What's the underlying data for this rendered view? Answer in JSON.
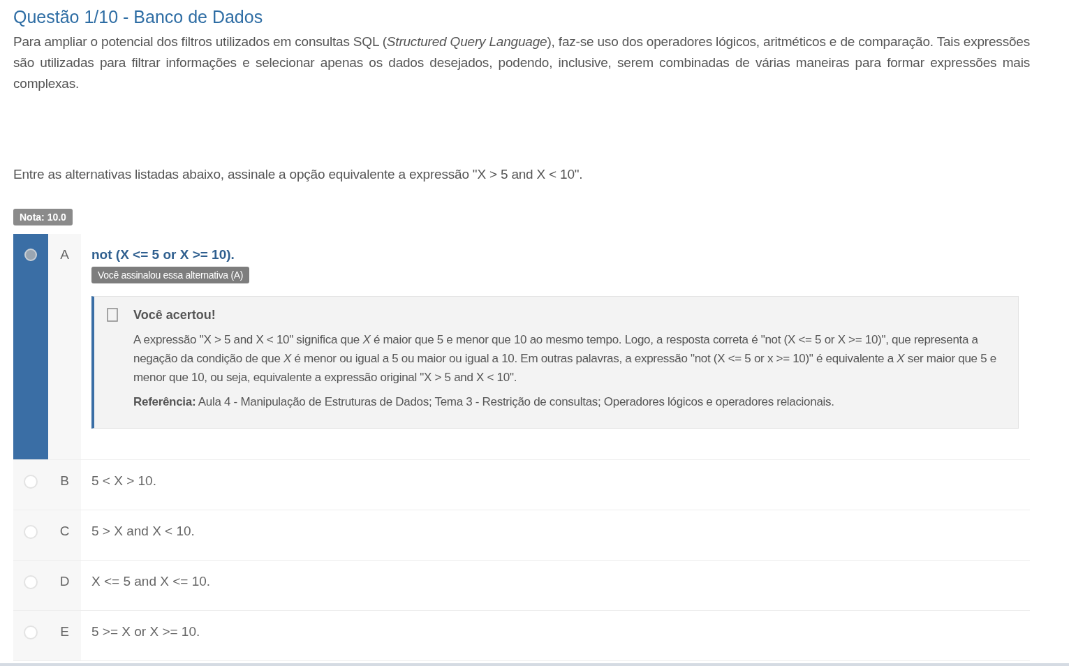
{
  "title": "Questão 1/10 - Banco de Dados",
  "intro": "Para ampliar o potencial dos filtros utilizados em consultas SQL (*Structured Query Language*), faz-se uso dos operadores lógicos, aritméticos e de comparação. Tais expressões são utilizadas para filtrar informações e selecionar apenas os dados desejados, podendo, inclusive, serem combinadas de várias maneiras para formar expressões mais complexas.",
  "question": "Entre as alternativas listadas abaixo, assinale a opção equivalente a expressão \"X > 5 and X < 10\".",
  "grade": "Nota: 10.0",
  "options": [
    {
      "letter": "A",
      "text": "not (X <= 5 or X >= 10).",
      "selected": true,
      "marked_label": "Você assinalou essa alternativa (A)",
      "feedback": {
        "title": "Você acertou!",
        "text": "A expressão \"X > 5 and X < 10\" significa que *X* é maior que 5 e menor que 10 ao mesmo tempo. Logo, a resposta correta é \"not (X <= 5 or X >= 10)\", que representa a negação da condição de que *X* é menor ou igual a 5 ou maior ou igual a 10. Em outras palavras, a expressão \"not (X <= 5 or x >= 10)\" é equivalente a *X* ser maior que 5 e menor que 10, ou seja, equivalente a expressão original \"X > 5 and X < 10\".",
        "reference": "**Referência:** Aula 4 - Manipulação de Estruturas de Dados; Tema 3 - Restrição de consultas; Operadores lógicos e operadores relacionais."
      }
    },
    {
      "letter": "B",
      "text": "5 < X > 10.",
      "selected": false
    },
    {
      "letter": "C",
      "text": "5 > X and X < 10.",
      "selected": false
    },
    {
      "letter": "D",
      "text": "X <= 5 and X <= 10.",
      "selected": false
    },
    {
      "letter": "E",
      "text": "5 >= X or X >= 10.",
      "selected": false
    }
  ]
}
